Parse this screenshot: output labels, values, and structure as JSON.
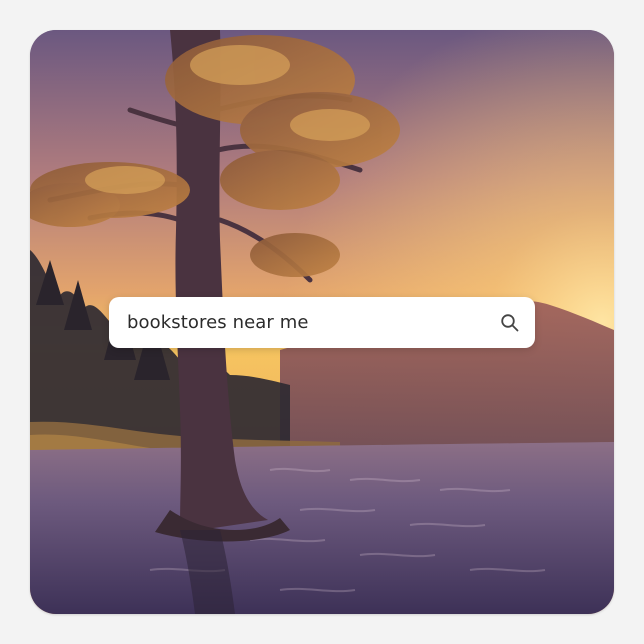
{
  "search": {
    "query": "bookstores near me",
    "icon": "search-icon"
  },
  "colors": {
    "sky_top": "#6e5a80",
    "sky_warm": "#f6c35e",
    "water": "#5b4a73",
    "search_bar": "#ffffff",
    "text": "#2b2b2b",
    "icon": "#444444"
  }
}
